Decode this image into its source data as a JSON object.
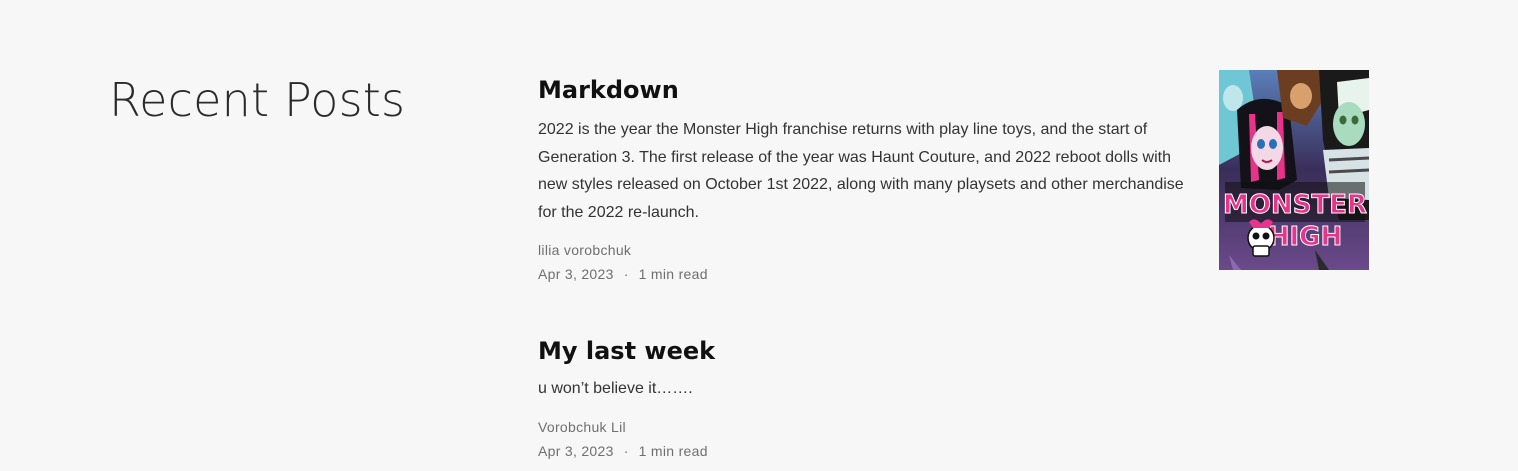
{
  "section": {
    "title": "Recent Posts"
  },
  "posts": [
    {
      "title": "Markdown",
      "excerpt": "2022 is the year the Monster High franchise returns with play line toys, and the start of Generation 3. The first release of the year was Haunt Couture, and 2022 reboot dolls with new styles released on October 1st 2022, along with many playsets and other merchandise for the 2022 re-launch.",
      "author": "lilia vorobchuk",
      "date": "Apr 3, 2023",
      "separator": "·",
      "read_time": "1 min read",
      "cover_logo": {
        "line1": "MONSTER",
        "line2": "HIGH"
      }
    },
    {
      "title": "My last week",
      "excerpt": "u won’t believe it…….",
      "author": "Vorobchuk Lil",
      "date": "Apr 3, 2023",
      "separator": "·",
      "read_time": "1 min read"
    }
  ],
  "colors": {
    "background": "#f7f7f7",
    "title": "#111111",
    "body_text": "#333333",
    "meta_text": "#6f6f6f",
    "logo_pink": "#e8338a"
  }
}
